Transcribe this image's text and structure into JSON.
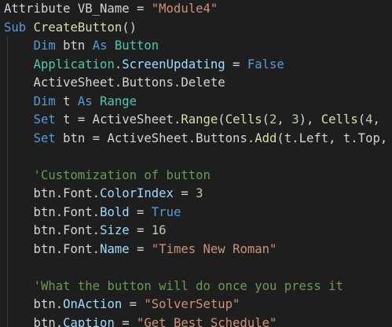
{
  "colors": {
    "background": "#1e1e1e",
    "plain": "#d4d4d4",
    "keyword": "#569cd6",
    "string": "#ce9178",
    "comment": "#6a9955",
    "type": "#4ec9b0",
    "member": "#9cdcfe",
    "function": "#dcdcaa",
    "number": "#b5cea8",
    "indent_guide": "#404040"
  },
  "code_lines": [
    [
      [
        "Attribute VB_Name = ",
        "plain"
      ],
      [
        "\"Module4\"",
        "string"
      ]
    ],
    [
      [
        "Sub ",
        "keyword"
      ],
      [
        "CreateButton",
        "function"
      ],
      [
        "()",
        "plain"
      ]
    ],
    [
      [
        "    ",
        "plain"
      ],
      [
        "Dim ",
        "keyword"
      ],
      [
        "btn ",
        "plain"
      ],
      [
        "As ",
        "keyword"
      ],
      [
        "Button",
        "type"
      ]
    ],
    [
      [
        "    ",
        "plain"
      ],
      [
        "Application",
        "type"
      ],
      [
        ".",
        "plain"
      ],
      [
        "ScreenUpdating",
        "member"
      ],
      [
        " = ",
        "plain"
      ],
      [
        "False",
        "keyword"
      ]
    ],
    [
      [
        "    ActiveSheet.Buttons.Delete",
        "plain"
      ]
    ],
    [
      [
        "    ",
        "plain"
      ],
      [
        "Dim ",
        "keyword"
      ],
      [
        "t ",
        "plain"
      ],
      [
        "As ",
        "keyword"
      ],
      [
        "Range",
        "type"
      ]
    ],
    [
      [
        "    ",
        "plain"
      ],
      [
        "Set ",
        "keyword"
      ],
      [
        "t = ActiveSheet.",
        "plain"
      ],
      [
        "Range",
        "function"
      ],
      [
        "(",
        "plain"
      ],
      [
        "Cells",
        "function"
      ],
      [
        "(",
        "plain"
      ],
      [
        "2",
        "number"
      ],
      [
        ", ",
        "plain"
      ],
      [
        "3",
        "number"
      ],
      [
        "), ",
        "plain"
      ],
      [
        "Cells",
        "function"
      ],
      [
        "(",
        "plain"
      ],
      [
        "4",
        "number"
      ],
      [
        ",",
        "plain"
      ]
    ],
    [
      [
        "    ",
        "plain"
      ],
      [
        "Set ",
        "keyword"
      ],
      [
        "btn = ActiveSheet.Buttons.",
        "plain"
      ],
      [
        "Add",
        "function"
      ],
      [
        "(t.Left, t.Top,",
        "plain"
      ]
    ],
    [
      [
        "",
        "plain"
      ]
    ],
    [
      [
        "    ",
        "plain"
      ],
      [
        "'Customization of button",
        "comment"
      ]
    ],
    [
      [
        "    btn.Font.",
        "plain"
      ],
      [
        "ColorIndex",
        "member"
      ],
      [
        " = ",
        "plain"
      ],
      [
        "3",
        "number"
      ]
    ],
    [
      [
        "    btn.Font.",
        "plain"
      ],
      [
        "Bold",
        "member"
      ],
      [
        " = ",
        "plain"
      ],
      [
        "True",
        "keyword"
      ]
    ],
    [
      [
        "    btn.Font.",
        "plain"
      ],
      [
        "Size",
        "member"
      ],
      [
        " = ",
        "plain"
      ],
      [
        "16",
        "number"
      ]
    ],
    [
      [
        "    btn.Font.",
        "plain"
      ],
      [
        "Name",
        "member"
      ],
      [
        " = ",
        "plain"
      ],
      [
        "\"Times New Roman\"",
        "string"
      ]
    ],
    [
      [
        "",
        "plain"
      ]
    ],
    [
      [
        "    ",
        "plain"
      ],
      [
        "'What the button will do once you press it",
        "comment"
      ]
    ],
    [
      [
        "    btn.",
        "plain"
      ],
      [
        "OnAction",
        "member"
      ],
      [
        " = ",
        "plain"
      ],
      [
        "\"SolverSetup\"",
        "string"
      ]
    ],
    [
      [
        "    btn.",
        "plain"
      ],
      [
        "Caption",
        "member"
      ],
      [
        " = ",
        "plain"
      ],
      [
        "\"Get Best Schedule\"",
        "string"
      ]
    ]
  ]
}
